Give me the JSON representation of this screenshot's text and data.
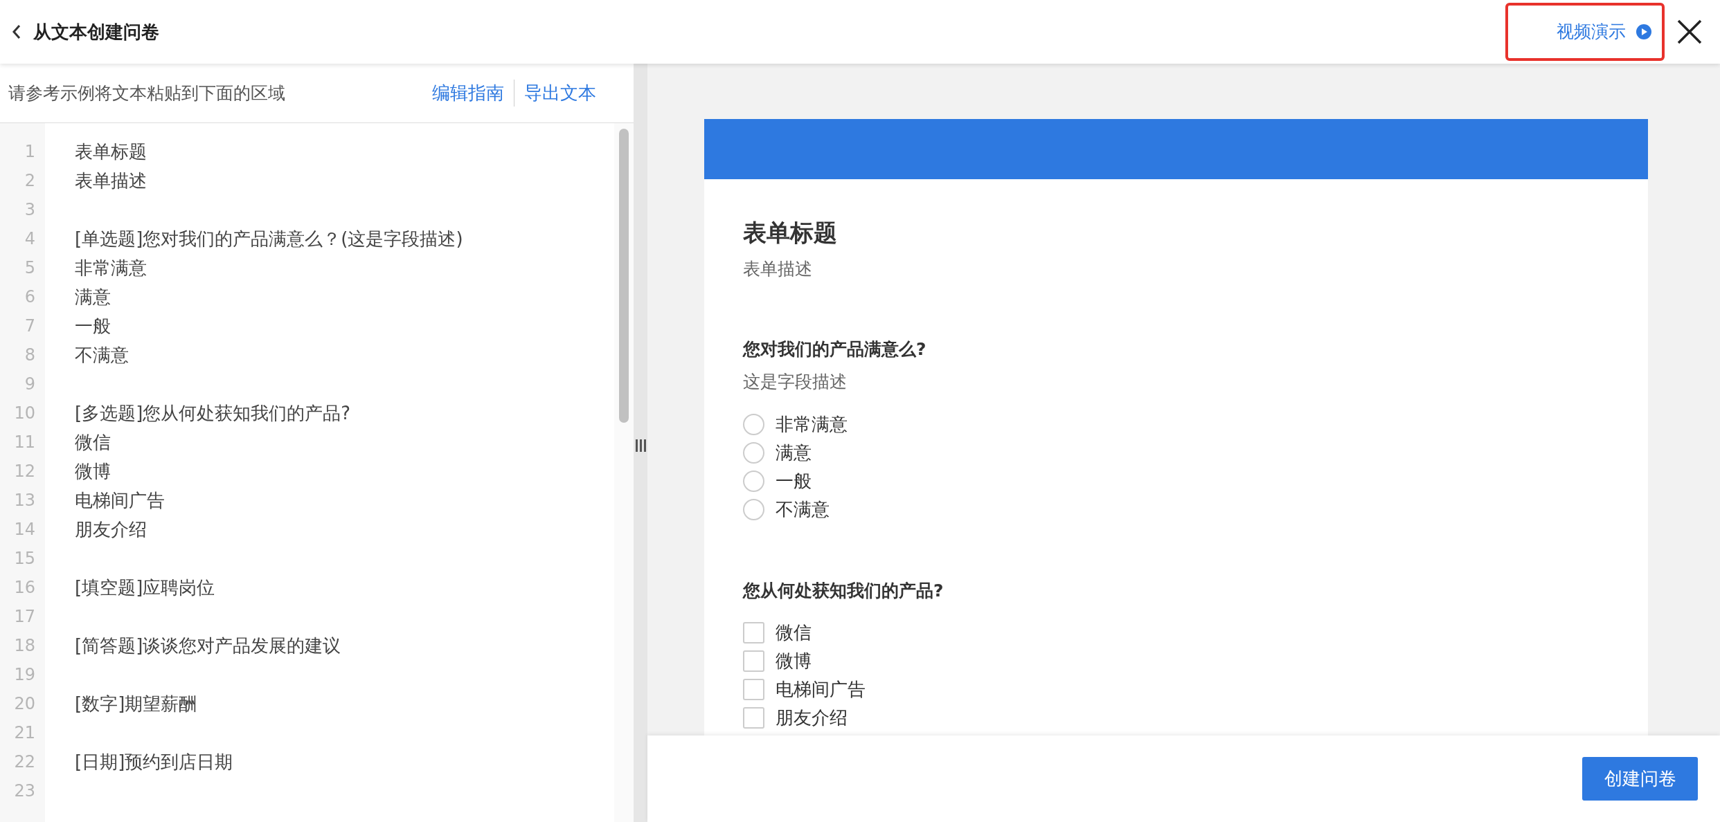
{
  "header": {
    "title": "从文本创建问卷",
    "video_link": {
      "label": "视频演示",
      "highlighted": true
    }
  },
  "editor_panel": {
    "prompt": "请参考示例将文本粘贴到下面的区域",
    "links": [
      "编辑指南",
      "导出文本"
    ],
    "lines": [
      {
        "number": "1",
        "text": "表单标题"
      },
      {
        "number": "2",
        "text": "表单描述"
      },
      {
        "number": "3"
      },
      {
        "number": "4",
        "text": "[单选题]您对我们的产品满意么？(这是字段描述)"
      },
      {
        "number": "5",
        "text": "非常满意"
      },
      {
        "number": "6",
        "text": "满意"
      },
      {
        "number": "7",
        "text": "一般"
      },
      {
        "number": "8",
        "text": "不满意"
      },
      {
        "number": "9"
      },
      {
        "number": "10",
        "text": "[多选题]您从何处获知我们的产品?"
      },
      {
        "number": "11",
        "text": "微信"
      },
      {
        "number": "12",
        "text": "微博"
      },
      {
        "number": "13",
        "text": "电梯间广告"
      },
      {
        "number": "14",
        "text": "朋友介绍"
      },
      {
        "number": "15"
      },
      {
        "number": "16",
        "text": "[填空题]应聘岗位"
      },
      {
        "number": "17"
      },
      {
        "number": "18",
        "text": "[简答题]谈谈您对产品发展的建议"
      },
      {
        "number": "19"
      },
      {
        "number": "20",
        "text": "[数字]期望薪酬"
      },
      {
        "number": "21"
      },
      {
        "number": "22",
        "text": "[日期]预约到店日期"
      },
      {
        "number": "23"
      }
    ]
  },
  "preview": {
    "form_title": "表单标题",
    "form_description": "表单描述",
    "questions": [
      {
        "kind": "radio",
        "title": "您对我们的产品满意么?",
        "description": "这是字段描述",
        "options": [
          {
            "label": "非常满意",
            "selected": false
          },
          {
            "label": "满意",
            "selected": false
          },
          {
            "label": "一般",
            "selected": false
          },
          {
            "label": "不满意",
            "selected": false
          }
        ]
      },
      {
        "kind": "checkbox",
        "title": "您从何处获知我们的产品?",
        "options": [
          {
            "label": "微信",
            "checked": false
          },
          {
            "label": "微博",
            "checked": false
          },
          {
            "label": "电梯间广告",
            "checked": false
          },
          {
            "label": "朋友介绍",
            "checked": false
          }
        ]
      }
    ]
  },
  "footer": {
    "button": "创建问卷"
  }
}
